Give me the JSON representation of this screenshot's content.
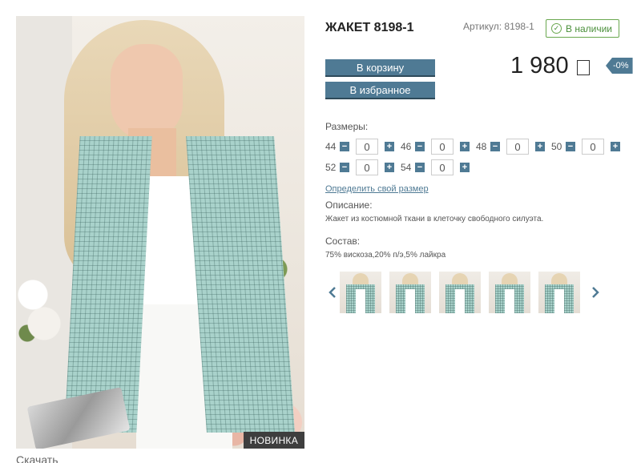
{
  "product": {
    "title": "ЖАКЕТ 8198-1",
    "sku_label": "Артикул: 8198-1",
    "stock_label": "В наличии",
    "price": "1 980",
    "discount": "-0%",
    "badge": "НОВИНКА"
  },
  "actions": {
    "cart_label": "В корзину",
    "favorite_label": "В избранное"
  },
  "sizes": {
    "label": "Размеры:",
    "items": [
      {
        "size": "44",
        "qty": "0"
      },
      {
        "size": "46",
        "qty": "0"
      },
      {
        "size": "48",
        "qty": "0"
      },
      {
        "size": "50",
        "qty": "0"
      },
      {
        "size": "52",
        "qty": "0"
      },
      {
        "size": "54",
        "qty": "0"
      }
    ],
    "minus": "−",
    "plus": "+",
    "find_size_link": "Определить свой размер"
  },
  "description": {
    "label": "Описание:",
    "text": "Жакет из костюмной ткани в клеточку свободного силуэта."
  },
  "composition": {
    "label": "Состав:",
    "text": "75% вискоза,20% п/э,5% лайкра"
  },
  "gallery": {
    "prev_icon": "chevron-left-icon",
    "next_icon": "chevron-right-icon",
    "thumb_count": 5
  },
  "footer_cut_text": "Скачать",
  "colors": {
    "accent": "#4f7a94",
    "stock_green": "#6aa84f",
    "fabric": "#a9d2cb"
  }
}
